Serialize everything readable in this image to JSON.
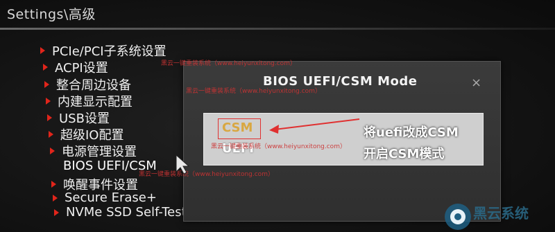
{
  "header": {
    "title": "Settings\\高级"
  },
  "menu": {
    "items": [
      {
        "label": "PCIe/PCI子系统设置"
      },
      {
        "label": "ACPI设置"
      },
      {
        "label": "整合周边设备"
      },
      {
        "label": "内建显示配置"
      },
      {
        "label": "USB设置"
      },
      {
        "label": "超级IO配置"
      },
      {
        "label": "电源管理设置"
      },
      {
        "label": "BIOS UEFI/CSM"
      },
      {
        "label": "唤醒事件设置"
      },
      {
        "label": "Secure Erase+"
      },
      {
        "label": "NVMe SSD Self-Test"
      }
    ]
  },
  "dialog": {
    "title": "BIOS UEFI/CSM Mode",
    "close": "×",
    "options": [
      "CSM",
      "UEFI"
    ]
  },
  "annotations": {
    "line1": "将uefi改成CSM",
    "line2": "开启CSM模式"
  },
  "watermark": {
    "text": "黑云一键重装系统（www.heiyunxitong.com）"
  },
  "logo": {
    "text": "黑云系统"
  },
  "colors": {
    "accent": "#e1251b",
    "csm_highlight": "#d9a741",
    "annotation_red": "#e03030"
  }
}
